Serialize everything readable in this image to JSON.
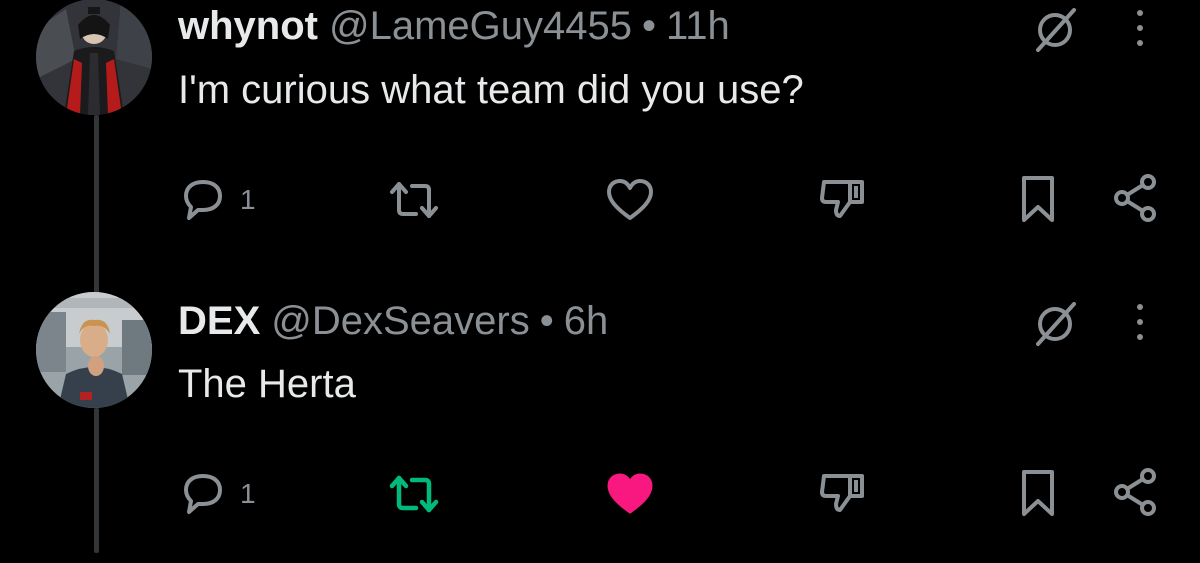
{
  "replies": [
    {
      "name": "whynot",
      "handle": "@LameGuy4455",
      "separator": "•",
      "time": "11h",
      "text": "I'm curious what team did you use?",
      "avatar_icon": "avatar-dark-robed-character",
      "actions": {
        "reply_count": "1",
        "reposted": false,
        "liked": false
      }
    },
    {
      "name": "DEX",
      "handle": "@DexSeavers",
      "separator": "•",
      "time": "6h",
      "text": "The Herta",
      "avatar_icon": "avatar-person-photo",
      "actions": {
        "reply_count": "1",
        "reposted": true,
        "liked": true
      }
    }
  ],
  "colors": {
    "background": "#000000",
    "text_primary": "#e7e9ea",
    "text_secondary": "#8b9095",
    "icon_gray": "#8b9095",
    "repost_active": "#00ba7c",
    "like_active": "#f91880",
    "thread_line": "#333639"
  },
  "icons": [
    "comment-icon",
    "repost-icon",
    "heart-icon",
    "dislike-icon",
    "bookmark-icon",
    "share-icon",
    "grok-icon",
    "more-icon"
  ]
}
